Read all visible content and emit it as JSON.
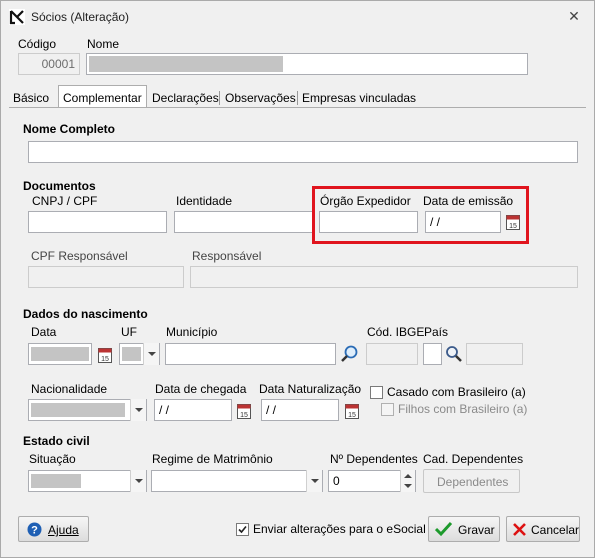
{
  "window": {
    "title": "Sócios (Alteração)"
  },
  "header": {
    "codigo_label": "Código",
    "codigo_value": "00001",
    "nome_label": "Nome"
  },
  "tabs": [
    {
      "label": "Básico",
      "active": false
    },
    {
      "label": "Complementar",
      "active": true
    },
    {
      "label": "Declarações",
      "active": false
    },
    {
      "label": "Observações",
      "active": false
    },
    {
      "label": "Empresas vinculadas",
      "active": false
    }
  ],
  "nome_completo": {
    "section": "Nome Completo"
  },
  "documentos": {
    "section": "Documentos",
    "cnpj_cpf_label": "CNPJ / CPF",
    "identidade_label": "Identidade",
    "orgao_label": "Órgão Expedidor",
    "data_emissao_label": "Data de emissão",
    "data_emissao_value": " / /",
    "cpf_resp_label": "CPF Responsável",
    "responsavel_label": "Responsável"
  },
  "nascimento": {
    "section": "Dados do nascimento",
    "data_label": "Data",
    "uf_label": "UF",
    "municipio_label": "Município",
    "cod_ibge_label": "Cód. IBGE",
    "pais_label": "País",
    "nacionalidade_label": "Nacionalidade",
    "data_chegada_label": "Data de chegada",
    "data_chegada_value": " / /",
    "data_naturalizacao_label": "Data Naturalização",
    "data_naturalizacao_value": " / /",
    "casado_label": "Casado com Brasileiro (a)",
    "filhos_label": "Filhos com Brasileiro (a)"
  },
  "estado_civil": {
    "section": "Estado civil",
    "situacao_label": "Situação",
    "regime_label": "Regime de Matrimônio",
    "n_dependentes_label": "Nº Dependentes",
    "n_dependentes_value": "0",
    "cad_dependentes_label": "Cad. Dependentes",
    "dependentes_button": "Dependentes"
  },
  "footer": {
    "ajuda_button": "Ajuda",
    "esocial_label": "Enviar alterações para o eSocial",
    "esocial_checked": true,
    "gravar_button": "Gravar",
    "cancelar_button": "Cancelar"
  },
  "colors": {
    "highlight": "#e0141e",
    "accent": "#1e5fb4"
  }
}
